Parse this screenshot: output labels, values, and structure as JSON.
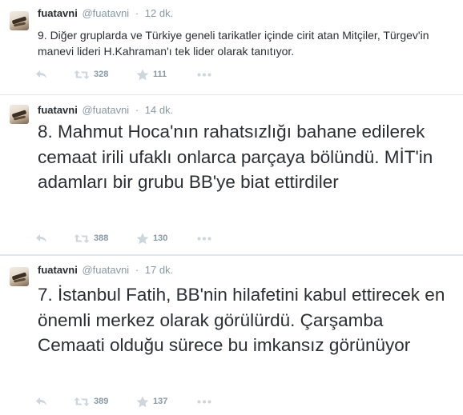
{
  "tweets": [
    {
      "name": "fuatavni",
      "handle": "@fuatavni",
      "separator": "·",
      "time": "12 dk.",
      "text": "9. Diğer gruplarda ve Türkiye geneli tarikatler içinde cirit atan Mitçiler, Türgev'in manevi lideri H.Kahraman'ı tek lider olarak tanıtıyor.",
      "retweets": "328",
      "favorites": "111"
    },
    {
      "name": "fuatavni",
      "handle": "@fuatavni",
      "separator": "·",
      "time": "14 dk.",
      "text": "8. Mahmut Hoca'nın rahatsızlığı bahane edilerek cemaat irili ufaklı onlarca parçaya bölündü. MİT'in adamları bir grubu BB'ye biat ettirdiler",
      "retweets": "388",
      "favorites": "130"
    },
    {
      "name": "fuatavni",
      "handle": "@fuatavni",
      "separator": "·",
      "time": "17 dk.",
      "text": "7. İstanbul Fatih, BB'nin hilafetini kabul ettirecek en önemli merkez olarak görülürdü. Çarşamba Cemaati olduğu sürece bu imkansız görünüyor",
      "retweets": "389",
      "favorites": "137"
    }
  ],
  "icons": {
    "reply": "reply-icon",
    "retweet": "retweet-icon",
    "favorite": "star-icon",
    "more": "more-dots-icon"
  },
  "colors": {
    "text": "#292f33",
    "muted": "#8899a6",
    "icon": "#ccd6dd",
    "divider": "#e1e8ed"
  }
}
